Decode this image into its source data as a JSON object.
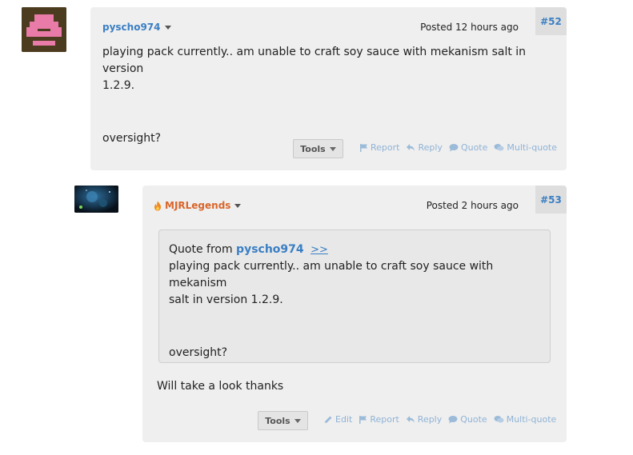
{
  "colors": {
    "link": "#3a7fc4",
    "staff_name": "#d9662b",
    "action": "#8fb3d6",
    "post_bg": "#efefef"
  },
  "posts": [
    {
      "number": "#52",
      "author": "pyscho974",
      "posted": "Posted 12 hours ago",
      "body": [
        "playing pack currently.. am unable to craft soy sauce with mekanism salt in version",
        "1.2.9.",
        "oversight?"
      ],
      "tools_label": "Tools",
      "actions": [
        "Report",
        "Reply",
        "Quote",
        "Multi-quote"
      ]
    },
    {
      "number": "#53",
      "author": "MJRLegends",
      "author_icon": "flame-icon",
      "posted": "Posted 2 hours ago",
      "quote": {
        "prefix": "Quote from",
        "author": "pyscho974",
        "link": ">>",
        "body": [
          "playing pack currently.. am unable to craft soy sauce with mekanism",
          "salt in version 1.2.9.",
          "oversight?"
        ]
      },
      "body": [
        "Will take a look thanks"
      ],
      "tools_label": "Tools",
      "actions": [
        "Edit",
        "Report",
        "Reply",
        "Quote",
        "Multi-quote"
      ]
    }
  ]
}
